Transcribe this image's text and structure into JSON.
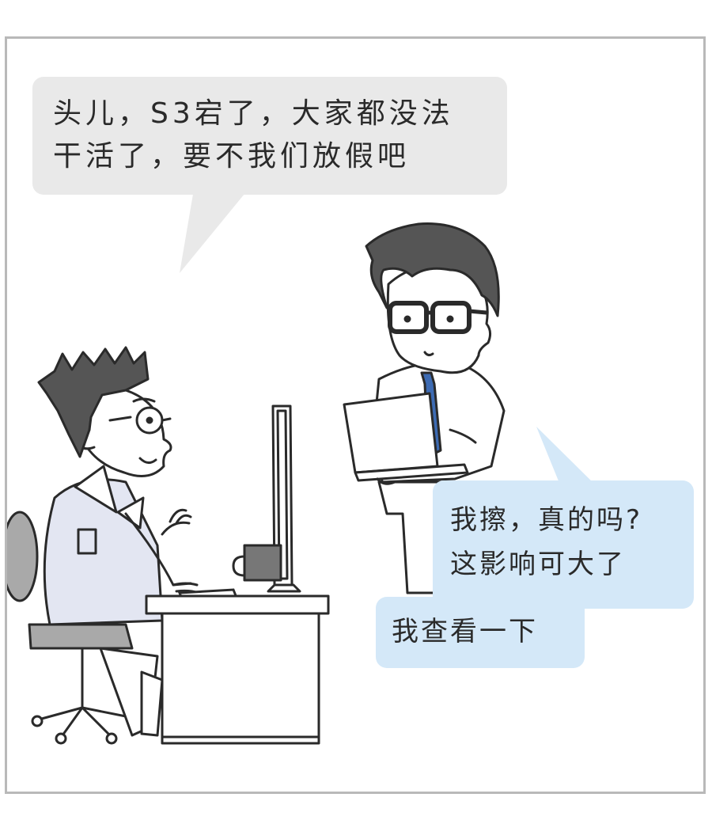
{
  "panel": {
    "bubbles": {
      "boss_request": {
        "lines": [
          "头儿，S3宕了，大家都没法",
          "干活了，要不我们放假吧"
        ]
      },
      "reply_1": {
        "lines": [
          "我擦，真的吗?",
          "这影响可大了"
        ]
      },
      "reply_2": {
        "lines": [
          "我查看一下"
        ]
      }
    }
  },
  "colors": {
    "panel_border": "#b9b9b9",
    "gray_bubble": "#e9e9e9",
    "blue_bubble": "#d4e8f8",
    "hair": "#555555",
    "shirt": "#e3e6f2",
    "tie": "#3d6bb3",
    "chair": "#a9a9a9",
    "mug": "#777777"
  }
}
